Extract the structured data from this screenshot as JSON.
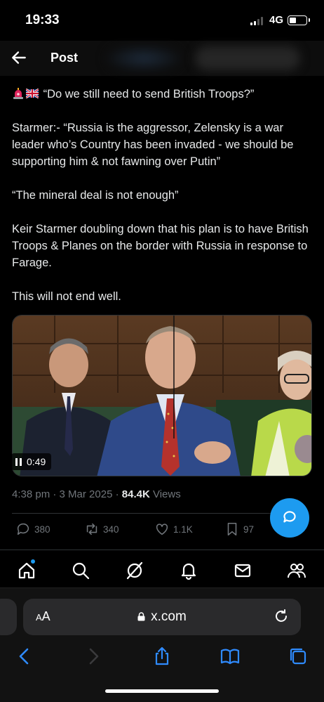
{
  "status": {
    "time": "19:33",
    "network": "4G"
  },
  "header": {
    "title": "Post"
  },
  "post": {
    "line1": "“Do we still need to send British Troops?”",
    "para2": "Starmer:- “Russia is the aggressor, Zelensky is a war leader who’s Country has been invaded - we should be supporting him & not fawning over Putin”",
    "para3": "“The mineral deal is not enough”",
    "para4": "Keir Starmer doubling down that his plan is to have British Troops & Planes on the border with Russia in response to Farage.",
    "para5": "This will not end well."
  },
  "video": {
    "duration": "0:49"
  },
  "meta": {
    "time": "4:38 pm",
    "sep1": " · ",
    "date": "3 Mar 2025",
    "sep2": " · ",
    "views_count": "84.4K",
    "views_label": " Views"
  },
  "actions": {
    "replies": "380",
    "reposts": "340",
    "likes": "1.1K",
    "bookmarks": "97"
  },
  "browser": {
    "aa_big": "A",
    "aa_small": "A",
    "url": "x.com"
  },
  "colors": {
    "accent": "#1d9bf0",
    "background": "#000000",
    "muted": "#71767b"
  }
}
